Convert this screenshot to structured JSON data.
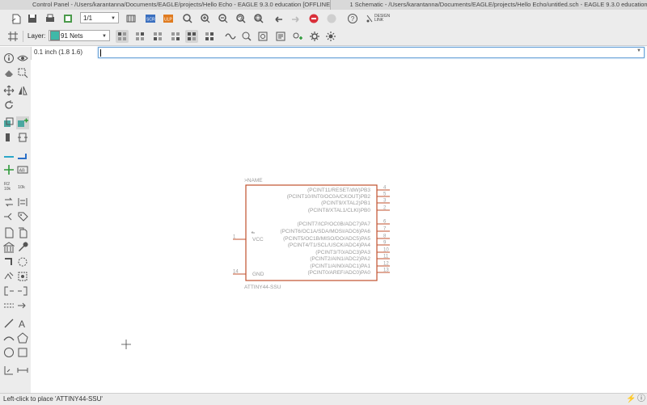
{
  "window": {
    "left_title": "Control Panel - /Users/karantanna/Documents/EAGLE/projects/Hello Echo - EAGLE 9.3.0 education [OFFLINE]",
    "right_title": "1 Schematic - /Users/karantanna/Documents/EAGLE/projects/Hello Echo/untitled.sch - EAGLE 9.3.0 education [OFFLINE]"
  },
  "toolbar1": {
    "sheet_value": "1/1",
    "design_link_label": "DESIGN LINK"
  },
  "toolbar2": {
    "layer_label": "Layer:",
    "layer_value": "91 Nets",
    "layer_color": "#3fb8a8"
  },
  "command": {
    "coordinate": "0.1 inch (1.8 1.6)",
    "input_value": ""
  },
  "component": {
    "name_label": ">NAME",
    "value_label": "ATTINY44-SSU",
    "border_color": "#c0502d",
    "right_pins": [
      {
        "label": "(PCINT11/RESET/dW)PB3",
        "number": "4"
      },
      {
        "label": "(PCINT10/INT0/OC0A/CKOUT)PB2",
        "number": "5"
      },
      {
        "label": "(PCINT9/XTAL2)PB1",
        "number": "3"
      },
      {
        "label": "(PCINT8/XTAL1/CLKI)PB0",
        "number": "2"
      },
      {
        "label": "(PCINT7/ICP/OC0B/ADC7)PA7",
        "number": "6"
      },
      {
        "label": "(PCINT6/OC1A/SDA/MOSI/ADC6)PA6",
        "number": "7"
      },
      {
        "label": "(PCINT5/OC1B/MISO/DO/ADC5)PA5",
        "number": "8"
      },
      {
        "label": "(PCINT4/T1/SCL/USCK/ADC4)PA4",
        "number": "9"
      },
      {
        "label": "(PCINT3/T0/ADC3)PA3",
        "number": "10"
      },
      {
        "label": "(PCINT2/AIN1/ADC2)PA2",
        "number": "11"
      },
      {
        "label": "(PCINT1/AIN0/ADC1)PA1",
        "number": "12"
      },
      {
        "label": "(PCINT0/AREF/ADC0)PA0",
        "number": "13"
      }
    ],
    "left_pins": [
      {
        "label": "VCC",
        "number": "1"
      },
      {
        "label": "GND",
        "number": "14"
      }
    ]
  },
  "status": {
    "message": "Left-click to place 'ATTINY44-SSU'"
  }
}
